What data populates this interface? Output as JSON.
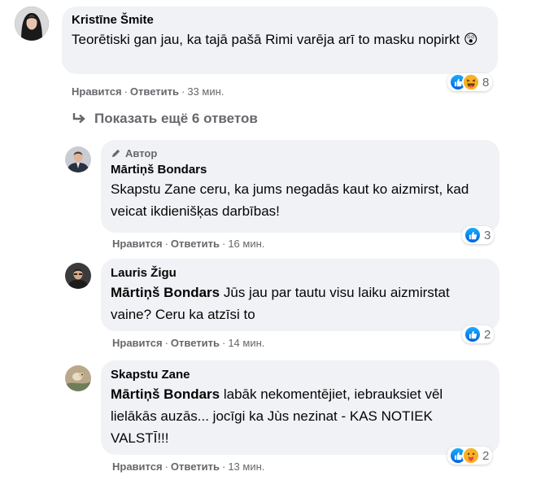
{
  "comments": [
    {
      "author": "Kristīne Šmite",
      "text": "Teorētiski gan jau, ka tajā pašā Rimi varēja arī to masku nopirkt",
      "emoji": "😲",
      "reaction_count": "8",
      "like_label": "Нравится",
      "reply_label": "Ответить",
      "time": "33 мин."
    },
    {
      "author_tag": "Автор",
      "author": "Mārtiņš Bondars",
      "text": "Skapstu Zane ceru, ka jums negadās kaut ko aizmirst, kad veicat ikdienišķas darbības!",
      "reaction_count": "3",
      "like_label": "Нравится",
      "reply_label": "Ответить",
      "time": "16 мин."
    },
    {
      "author": "Lauris Žigu",
      "mention": "Mārtiņš Bondars",
      "text": "Jūs jau par tautu visu laiku aizmirstat vaine? Ceru ka atzīsi to",
      "reaction_count": "2",
      "like_label": "Нравится",
      "reply_label": "Ответить",
      "time": "14 мин."
    },
    {
      "author": "Skapstu Zane",
      "mention": "Mārtiņš Bondars",
      "text": "labāk nekomentējiet, iebrauksiet vēl lielākās auzās... jocīgi ka Jùs nezinat - KAS NOTIEK VALSTĪ!!!",
      "reaction_count": "2",
      "like_label": "Нравится",
      "reply_label": "Ответить",
      "time": "13 мин."
    }
  ],
  "show_more": "Показать ещё 6 ответов",
  "colors": {
    "bubble": "#f0f2f5",
    "meta": "#65676b",
    "like": "#1877f2",
    "haha": "#f7b125"
  }
}
